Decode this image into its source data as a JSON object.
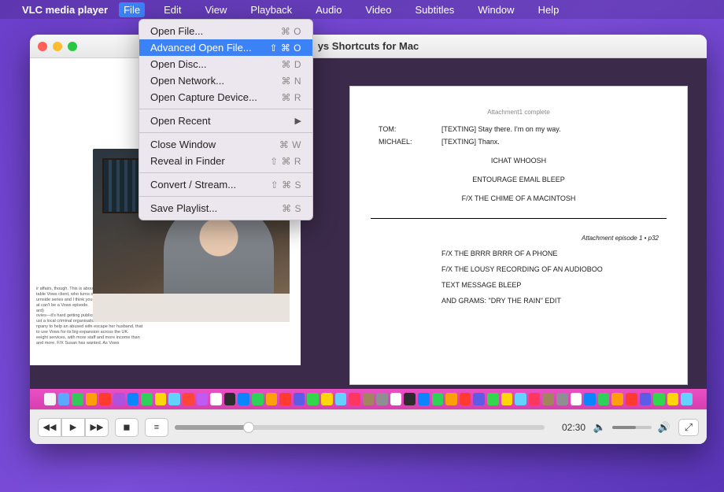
{
  "menubar": {
    "app_name": "VLC media player",
    "items": [
      "File",
      "Edit",
      "View",
      "Playback",
      "Audio",
      "Video",
      "Subtitles",
      "Window",
      "Help"
    ],
    "open_index": 0
  },
  "file_menu": {
    "groups": [
      [
        {
          "label": "Open File...",
          "shortcut": "⌘ O"
        },
        {
          "label": "Advanced Open File...",
          "shortcut": "⇧ ⌘ O",
          "highlighted": true
        },
        {
          "label": "Open Disc...",
          "shortcut": "⌘ D"
        },
        {
          "label": "Open Network...",
          "shortcut": "⌘ N"
        },
        {
          "label": "Open Capture Device...",
          "shortcut": "⌘ R"
        }
      ],
      [
        {
          "label": "Open Recent",
          "submenu": true
        }
      ],
      [
        {
          "label": "Close Window",
          "shortcut": "⌘ W"
        },
        {
          "label": "Reveal in Finder",
          "shortcut": "⇧ ⌘ R"
        }
      ],
      [
        {
          "label": "Convert / Stream...",
          "shortcut": "⇧ ⌘ S"
        }
      ],
      [
        {
          "label": "Save Playlist...",
          "shortcut": "⌘ S"
        }
      ]
    ]
  },
  "window": {
    "title": "ys Shortcuts for Mac",
    "time_display": "02:30"
  },
  "right_doc": {
    "header": "Attachment1 complete",
    "lines": [
      {
        "name": "TOM:",
        "text": "[TEXTING] Stay there. I'm on my way."
      },
      {
        "name": "MICHAEL:",
        "text": "[TEXTING] Thanx."
      }
    ],
    "center_lines": [
      "ICHAT WHOOSH",
      "ENTOURAGE EMAIL BLEEP",
      "F/X THE CHIME OF A MACINTOSH"
    ],
    "page_label": "Attachment episode 1 • p32",
    "body_lines": [
      "F/X THE BRRR BRRR OF A PHONE",
      "F/X THE LOUSY RECORDING OF AN AUDIOBOO",
      "TEXT MESSAGE BLEEP",
      "AND GRAMS: \"DRY THE RAIN\" EDIT"
    ]
  },
  "left_doc": {
    "snippets": [
      "ir affairs, though. This is about betrayal. And you will be",
      "table Vows client, who turns out to be incendiary.",
      "urnside series and I think you can see how readily it adapts",
      "at can't be a Vows episode.",
      "ard)",
      "ovies—it's hard getting publicity when your business is to",
      "ust a local criminal organisation has heard of it. As Susan",
      "npany to help an abused wife escape her husband, that",
      "to use Vows for its big expansion across the UK.",
      "eeight services, with more staff and more income than",
      "and more.                    F/X Susan has wanted. As Vows"
    ]
  },
  "dock_colors": [
    "#f5f5f7",
    "#5aa9ff",
    "#34c759",
    "#ff9f0a",
    "#ff3b30",
    "#af52de",
    "#0a84ff",
    "#30d158",
    "#ffd60a",
    "#64d2ff",
    "#ff453a",
    "#bf5af2",
    "#ffffff",
    "#2c2c2e",
    "#0a84ff",
    "#30d158",
    "#ff9f0a",
    "#ff3b30",
    "#5e5ce6",
    "#32d74b",
    "#ffd60a",
    "#64d2ff",
    "#ff375f",
    "#a2845e",
    "#8e8e93",
    "#ffffff",
    "#2c2c2e",
    "#0a84ff",
    "#30d158",
    "#ff9f0a",
    "#ff3b30",
    "#5e5ce6",
    "#32d74b",
    "#ffd60a",
    "#64d2ff",
    "#ff375f",
    "#a2845e",
    "#8e8e93",
    "#ffffff",
    "#0a84ff",
    "#30d158",
    "#ff9f0a",
    "#ff3b30",
    "#5e5ce6",
    "#32d74b",
    "#ffd60a",
    "#64d2ff"
  ]
}
